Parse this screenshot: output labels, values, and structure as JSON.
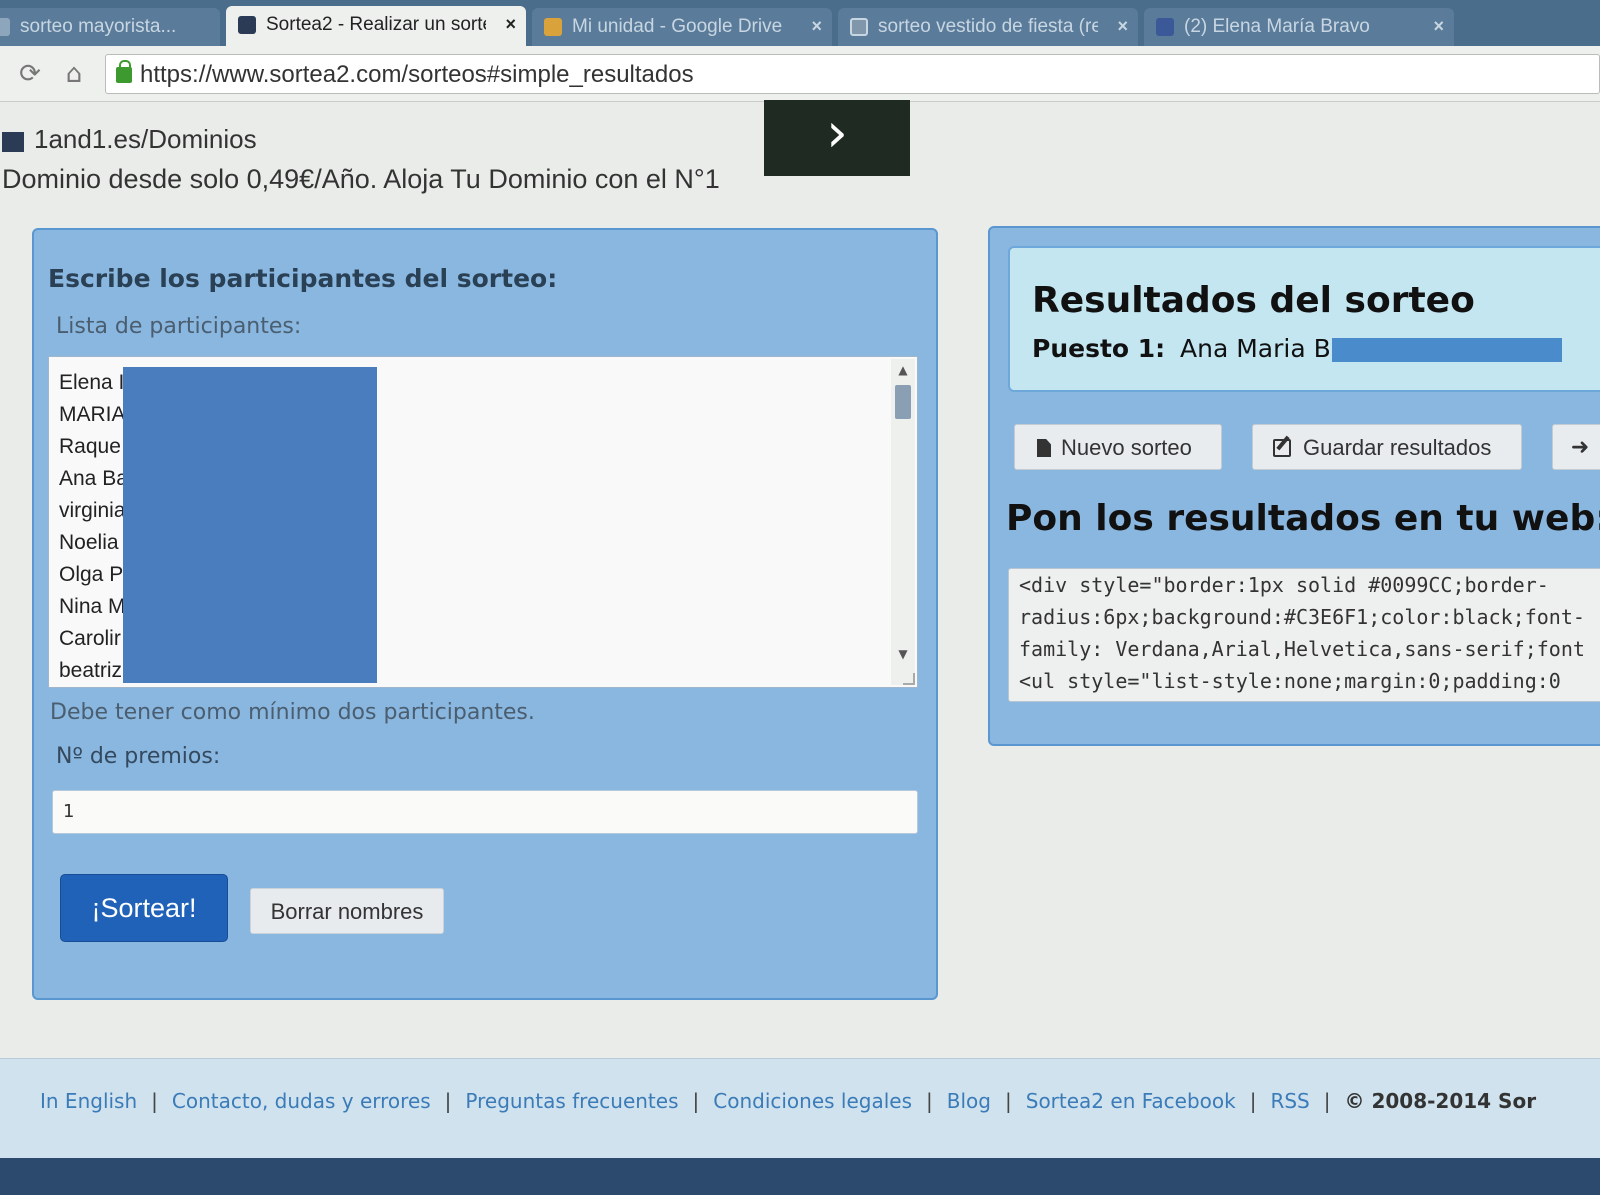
{
  "browser": {
    "tabs": [
      {
        "title": "sorteo mayorista...",
        "active": false
      },
      {
        "title": "Sortea2 - Realizar un sorte",
        "active": true
      },
      {
        "title": "Mi unidad - Google Drive",
        "active": false
      },
      {
        "title": "sorteo vestido de fiesta (re",
        "active": false
      },
      {
        "title": "(2) Elena María Bravo",
        "active": false
      }
    ],
    "url": "https://www.sortea2.com/sorteos#simple_resultados"
  },
  "ad": {
    "host": "1and1.es/Dominios",
    "text": "Dominio desde solo 0,49€/Año. Aloja Tu Dominio con el N°1",
    "arrow": "›"
  },
  "participants_form": {
    "heading": "Escribe los participantes del sorteo:",
    "list_label": "Lista de participantes:",
    "names": [
      "Elena I",
      "MARIA",
      "Raque",
      "Ana Ba",
      "virginia",
      "Noelia",
      "Olga P",
      "Nina M",
      "Carolir",
      "beatriz"
    ],
    "min_note": "Debe tener como mínimo dos participantes.",
    "prizes_label": "Nº de premios:",
    "prizes_value": "1",
    "draw_button": "¡Sortear!",
    "clear_button": "Borrar nombres"
  },
  "results": {
    "title": "Resultados del sorteo",
    "place_label": "Puesto 1:",
    "place_name": "Ana Maria Br",
    "new_button": "Nuevo sorteo",
    "save_button": "Guardar resultados",
    "share_button": "➜",
    "embed_title": "Pon los resultados en tu web:",
    "code_lines": [
      "<div style=\"border:1px solid #0099CC;border-",
      "radius:6px;background:#C3E6F1;color:black;font-",
      "family: Verdana,Arial,Helvetica,sans-serif;font",
      "<ul style=\"list-style:none;margin:0;padding:0"
    ]
  },
  "footer": {
    "links": [
      "In English",
      "Contacto, dudas y errores",
      "Preguntas frecuentes",
      "Condiciones legales",
      "Blog",
      "Sortea2 en Facebook",
      "RSS"
    ],
    "copyright": "© 2008-2014 Sor"
  },
  "colors": {
    "panel_blue": "#8ab7e0",
    "results_bg": "#C3E6F1",
    "primary_button": "#1f62b8",
    "link": "#3b7bb8"
  }
}
